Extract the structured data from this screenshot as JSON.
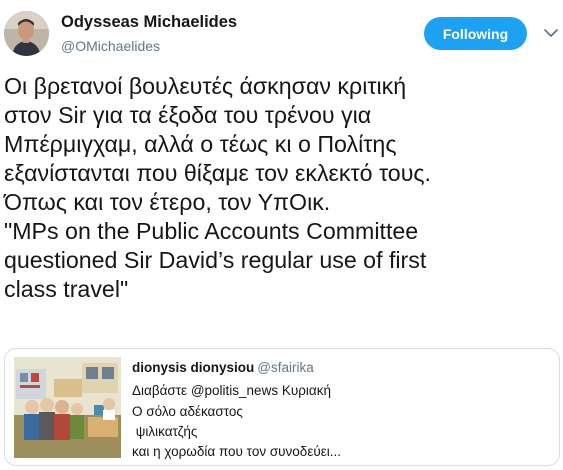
{
  "author": {
    "name": "Odysseas Michaelides",
    "handle": "@OMichaelides",
    "avatar_icon": "profile-photo"
  },
  "follow_button": {
    "label": "Following",
    "color": "#1da1f2"
  },
  "menu_icon": "chevron-down-icon",
  "tweet": {
    "lines": [
      "Οι βρετανοί βουλευτές άσκησαν κριτική",
      "στον Sir για τα έξοδα του τρένου για",
      "Μπέρμιγχαμ, αλλά ο τέως κι ο Πολίτης",
      "εξανίστανται που θίξαμε τον εκλεκτό τους.",
      "Όπως και τον έτερο, τον ΥπΟικ.",
      "\"MPs on the Public Accounts Committee",
      "questioned Sir David’s regular use of first",
      "class travel\""
    ]
  },
  "quoted_tweet": {
    "name": "dionysis dionysiou",
    "handle": "@sfairika",
    "lines": [
      "Διαβάστε @politis_news Κυριακή",
      "Ο σόλο αδέκαστος",
      " ψιλικατζής",
      "και η χορωδία που τον συνοδεύει..."
    ],
    "media_icon": "cartoon-image"
  }
}
